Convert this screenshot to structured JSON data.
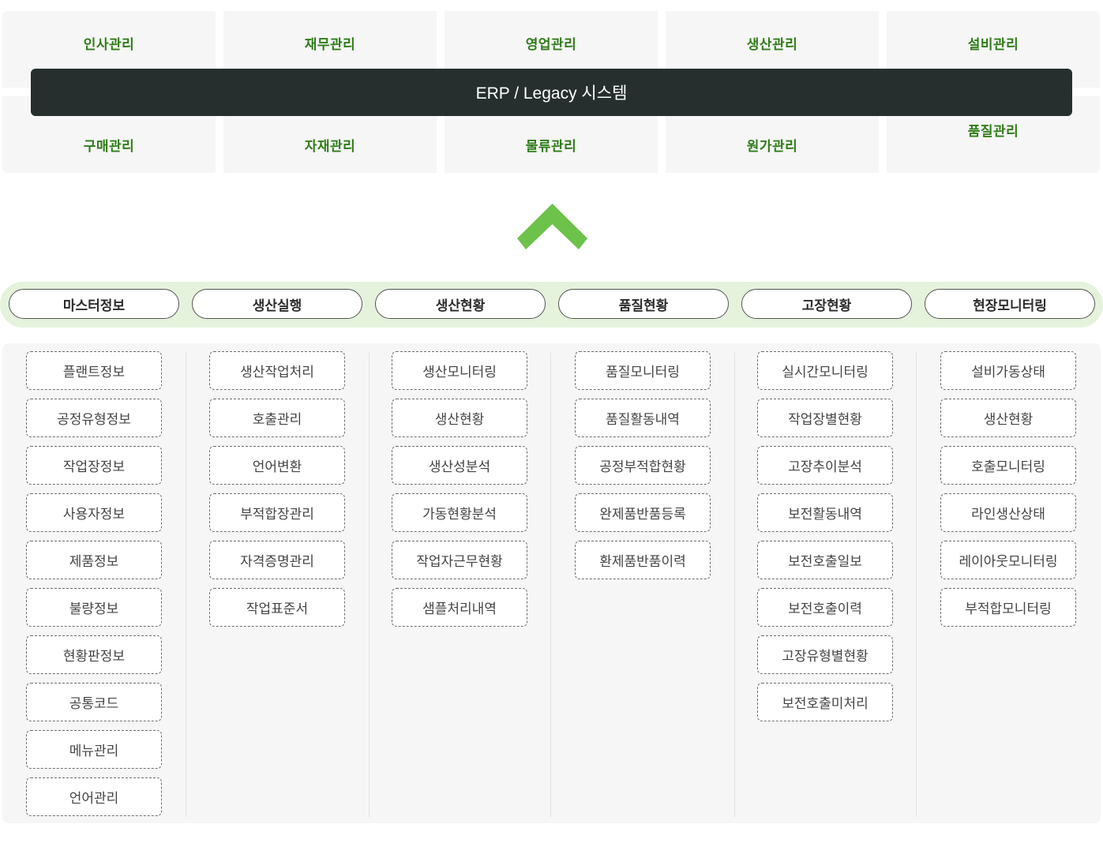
{
  "erp": {
    "title": "ERP / Legacy 시스템",
    "top_modules": [
      "인사관리",
      "재무관리",
      "영업관리",
      "생산관리",
      "설비관리"
    ],
    "bottom_modules": [
      "구매관리",
      "자재관리",
      "물류관리",
      "원가관리",
      "품질관리"
    ]
  },
  "categories": [
    "마스터정보",
    "생산실행",
    "생산현황",
    "품질현황",
    "고장현황",
    "현장모니터링"
  ],
  "columns": [
    [
      "플랜트정보",
      "공정유형정보",
      "작업장정보",
      "사용자정보",
      "제품정보",
      "불량정보",
      "현황판정보",
      "공통코드",
      "메뉴관리",
      "언어관리"
    ],
    [
      "생산작업처리",
      "호출관리",
      "언어변환",
      "부적합장관리",
      "자격증명관리",
      "작업표준서"
    ],
    [
      "생산모니터링",
      "생산현황",
      "생산성분석",
      "가동현황분석",
      "작업자근무현황",
      "샘플처리내역"
    ],
    [
      "품질모니터링",
      "품질활동내역",
      "공정부적합현황",
      "완제품반품등록",
      "환제품반품이력"
    ],
    [
      "실시간모니터링",
      "작업장별현황",
      "고장추이분석",
      "보전활동내역",
      "보전호출일보",
      "보전호출이력",
      "고장유형별현황",
      "보전호출미처리"
    ],
    [
      "설비가동상태",
      "생산현황",
      "호출모니터링",
      "라인생산상태",
      "레이아웃모니터링",
      "부적합모니터링"
    ]
  ],
  "colors": {
    "module_text": "#2f7d18",
    "erp_bar": "#262e2e",
    "arrow": "#6cc24a",
    "category_bar": "#e5f2dc"
  },
  "icons": {
    "arrow": "chevron-up-icon"
  }
}
